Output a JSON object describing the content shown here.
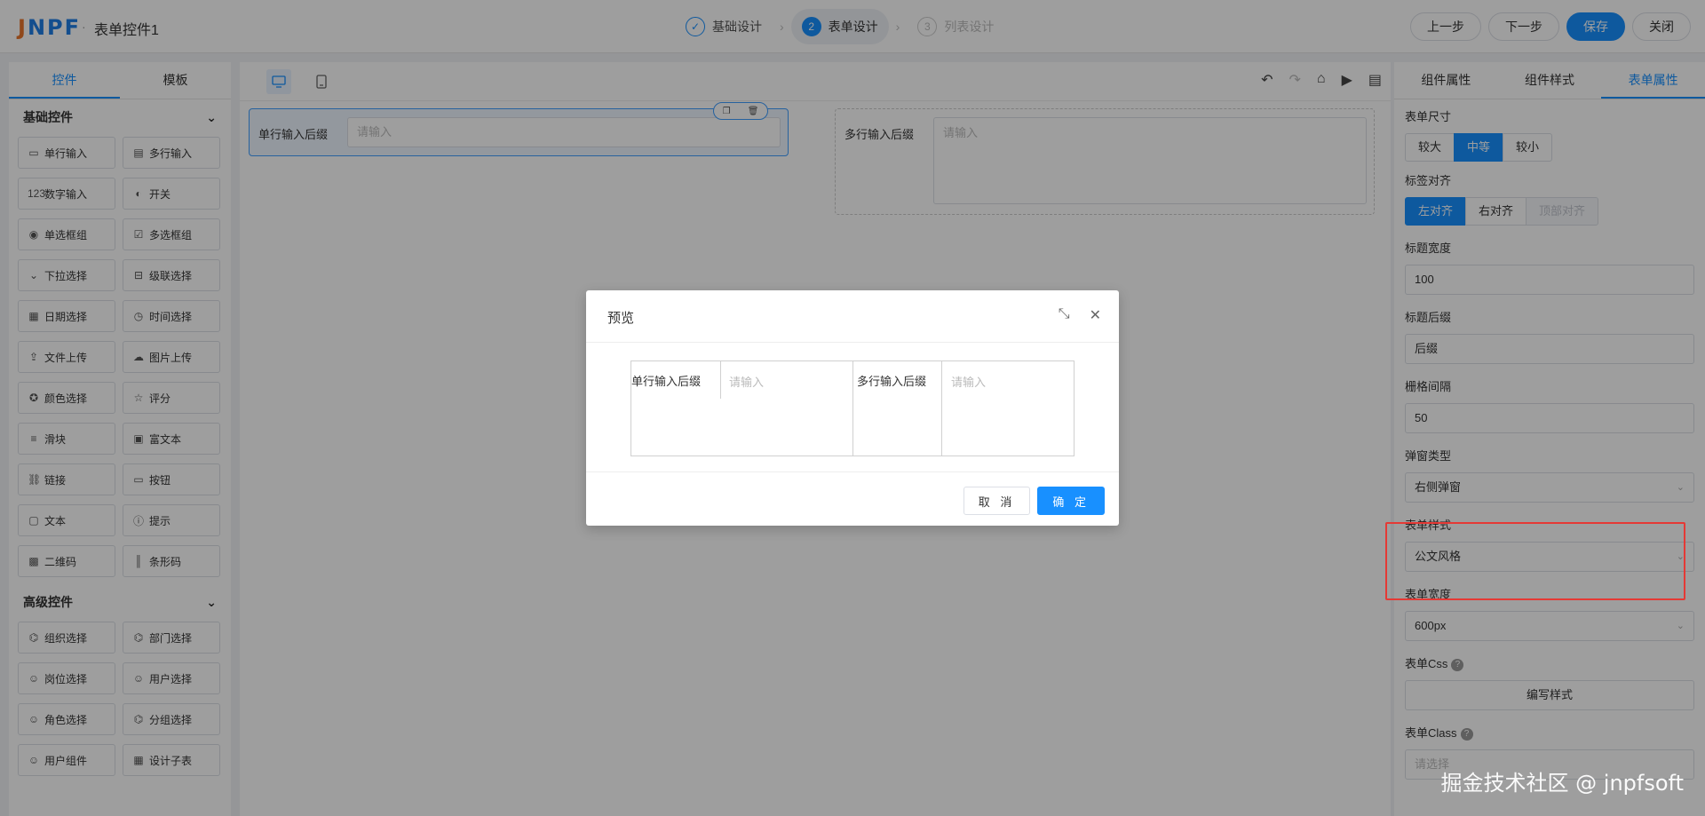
{
  "header": {
    "logo": "JNPF",
    "title": "表单控件1",
    "steps": [
      {
        "num": "✓",
        "label": "基础设计",
        "state": "done"
      },
      {
        "num": "2",
        "label": "表单设计",
        "state": "active"
      },
      {
        "num": "3",
        "label": "列表设计",
        "state": "disabled"
      }
    ],
    "prev_label": "上一步",
    "next_label": "下一步",
    "save_label": "保存",
    "close_label": "关闭"
  },
  "left": {
    "tabs": [
      "控件",
      "模板"
    ],
    "basic_title": "基础控件",
    "basic": [
      {
        "icon": "▭",
        "label": "单行输入"
      },
      {
        "icon": "▤",
        "label": "多行输入"
      },
      {
        "icon": "123",
        "label": "数字输入"
      },
      {
        "icon": "◐",
        "label": "开关"
      },
      {
        "icon": "◉",
        "label": "单选框组"
      },
      {
        "icon": "☑",
        "label": "多选框组"
      },
      {
        "icon": "⌄",
        "label": "下拉选择"
      },
      {
        "icon": "⊟",
        "label": "级联选择"
      },
      {
        "icon": "▦",
        "label": "日期选择"
      },
      {
        "icon": "◷",
        "label": "时间选择"
      },
      {
        "icon": "⇪",
        "label": "文件上传"
      },
      {
        "icon": "☁",
        "label": "图片上传"
      },
      {
        "icon": "✪",
        "label": "颜色选择"
      },
      {
        "icon": "☆",
        "label": "评分"
      },
      {
        "icon": "≡",
        "label": "滑块"
      },
      {
        "icon": "▣",
        "label": "富文本"
      },
      {
        "icon": "⛓",
        "label": "链接"
      },
      {
        "icon": "▭",
        "label": "按钮"
      },
      {
        "icon": "▢",
        "label": "文本"
      },
      {
        "icon": "ⓘ",
        "label": "提示"
      },
      {
        "icon": "▩",
        "label": "二维码"
      },
      {
        "icon": "║",
        "label": "条形码"
      }
    ],
    "advanced_title": "高级控件",
    "advanced": [
      {
        "icon": "⌬",
        "label": "组织选择"
      },
      {
        "icon": "⌬",
        "label": "部门选择"
      },
      {
        "icon": "☺",
        "label": "岗位选择"
      },
      {
        "icon": "☺",
        "label": "用户选择"
      },
      {
        "icon": "☺",
        "label": "角色选择"
      },
      {
        "icon": "⌬",
        "label": "分组选择"
      },
      {
        "icon": "☺",
        "label": "用户组件"
      },
      {
        "icon": "▦",
        "label": "设计子表"
      }
    ]
  },
  "canvas": {
    "field1_label": "单行输入后缀",
    "field1_placeholder": "请输入",
    "field2_label": "多行输入后缀",
    "field2_placeholder": "请输入"
  },
  "right": {
    "tabs": [
      "组件属性",
      "组件样式",
      "表单属性"
    ],
    "size_label": "表单尺寸",
    "size_options": [
      "较大",
      "中等",
      "较小"
    ],
    "align_label": "标签对齐",
    "align_options": [
      "左对齐",
      "右对齐",
      "顶部对齐"
    ],
    "title_width_label": "标题宽度",
    "title_width_value": "100",
    "title_suffix_label": "标题后缀",
    "title_suffix_value": "后缀",
    "grid_gap_label": "栅格间隔",
    "grid_gap_value": "50",
    "popup_type_label": "弹窗类型",
    "popup_type_value": "右侧弹窗",
    "form_style_label": "表单样式",
    "form_style_value": "公文风格",
    "form_width_label": "表单宽度",
    "form_width_value": "600px",
    "form_css_label": "表单Css",
    "form_css_button": "编写样式",
    "form_class_label": "表单Class",
    "form_class_placeholder": "请选择"
  },
  "modal": {
    "title": "预览",
    "col1_label": "单行输入后缀",
    "col1_placeholder": "请输入",
    "col2_label": "多行输入后缀",
    "col2_placeholder": "请输入",
    "cancel_label": "取 消",
    "ok_label": "确 定"
  },
  "watermark": "掘金技术社区 @ jnpfsoft",
  "colors": {
    "primary": "#1890ff",
    "highlight": "#e53935"
  }
}
